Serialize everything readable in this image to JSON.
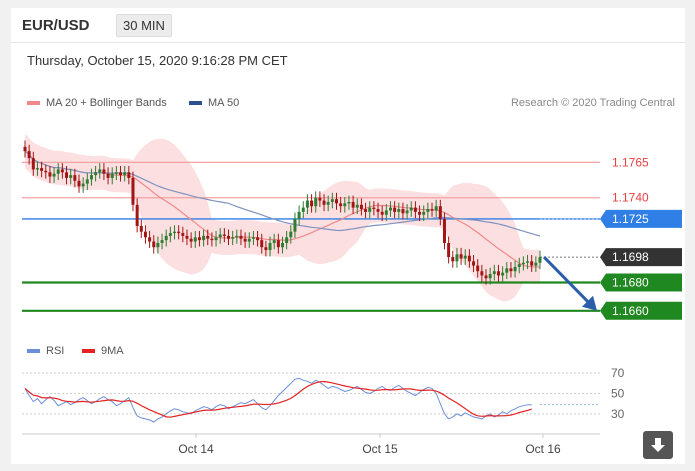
{
  "header": {
    "symbol": "EUR/USD",
    "interval": "30 MIN"
  },
  "datetime": "Thursday, October 15, 2020 9:16:28 PM CET",
  "legend": {
    "ma20": "MA 20 + Bollinger Bands",
    "ma50": "MA 50",
    "rsi": "RSI",
    "ma9": "9MA"
  },
  "credit": "Research © 2020 Trading Central",
  "colors": {
    "ma20": "#f08a8a",
    "ma50": "#3b6fc4",
    "band": "#fbd9da",
    "candle_up": "#2e7d32",
    "candle_down": "#a31515",
    "resistance": "#e74040",
    "support": "#208820",
    "pivot": "#2f7fe6",
    "price": "#333333",
    "arrow": "#2b5ea8",
    "rsi": "#6a8fd8",
    "rsi_ma": "#e42222"
  },
  "chart_data": {
    "type": "candlestick",
    "price_ylim": [
      1.1645,
      1.1795
    ],
    "levels": [
      {
        "label": "1.1765",
        "value": 1.1765,
        "kind": "resistance"
      },
      {
        "label": "1.1740",
        "value": 1.174,
        "kind": "resistance"
      },
      {
        "label": "1.1725",
        "value": 1.1725,
        "kind": "pivot"
      },
      {
        "label": "1.1698",
        "value": 1.1698,
        "kind": "price"
      },
      {
        "label": "1.1680",
        "value": 1.168,
        "kind": "support"
      },
      {
        "label": "1.1660",
        "value": 1.166,
        "kind": "support"
      }
    ],
    "x_ticks": [
      "Oct 14",
      "Oct 15",
      "Oct 16"
    ],
    "close": [
      1.1773,
      1.1768,
      1.176,
      1.1761,
      1.1759,
      1.1758,
      1.1755,
      1.1757,
      1.176,
      1.1758,
      1.1754,
      1.1756,
      1.1752,
      1.1748,
      1.175,
      1.1753,
      1.1756,
      1.1758,
      1.176,
      1.1757,
      1.1754,
      1.1757,
      1.1758,
      1.1756,
      1.1758,
      1.1754,
      1.1735,
      1.172,
      1.1716,
      1.1712,
      1.1709,
      1.1705,
      1.1708,
      1.171,
      1.1713,
      1.1715,
      1.1716,
      1.1715,
      1.1713,
      1.1711,
      1.1709,
      1.1712,
      1.171,
      1.1713,
      1.1711,
      1.171,
      1.1712,
      1.1714,
      1.1713,
      1.1711,
      1.1712,
      1.1713,
      1.1711,
      1.1709,
      1.1711,
      1.1712,
      1.171,
      1.1705,
      1.1703,
      1.1708,
      1.171,
      1.1705,
      1.1708,
      1.1712,
      1.1716,
      1.1725,
      1.173,
      1.1733,
      1.1738,
      1.1734,
      1.174,
      1.1738,
      1.1735,
      1.1737,
      1.1739,
      1.1736,
      1.1734,
      1.1736,
      1.1737,
      1.1733,
      1.1735,
      1.1732,
      1.173,
      1.1733,
      1.1732,
      1.173,
      1.1728,
      1.1731,
      1.1733,
      1.173,
      1.1732,
      1.1729,
      1.1731,
      1.1733,
      1.173,
      1.1728,
      1.173,
      1.1732,
      1.1731,
      1.1734,
      1.1725,
      1.1708,
      1.1698,
      1.1695,
      1.17,
      1.1697,
      1.1699,
      1.1695,
      1.1692,
      1.1688,
      1.1685,
      1.1683,
      1.1686,
      1.1688,
      1.1685,
      1.1687,
      1.169,
      1.1688,
      1.1691,
      1.1693,
      1.1694,
      1.1695,
      1.1692,
      1.1694,
      1.1698
    ],
    "rsi_ylim": [
      20,
      80
    ],
    "rsi_ticks": [
      "70",
      "50",
      "30"
    ],
    "rsi": [
      55,
      48,
      42,
      45,
      40,
      44,
      47,
      43,
      38,
      40,
      42,
      39,
      41,
      44,
      46,
      43,
      40,
      42,
      45,
      47,
      44,
      42,
      38,
      40,
      43,
      46,
      36,
      28,
      26,
      25,
      24,
      22,
      25,
      27,
      30,
      33,
      35,
      34,
      32,
      31,
      30,
      33,
      35,
      37,
      36,
      34,
      37,
      39,
      38,
      35,
      37,
      39,
      41,
      40,
      42,
      44,
      40,
      36,
      34,
      38,
      43,
      48,
      52,
      56,
      60,
      64,
      65,
      63,
      62,
      60,
      63,
      61,
      58,
      55,
      57,
      56,
      54,
      52,
      53,
      55,
      57,
      54,
      51,
      50,
      52,
      55,
      57,
      54,
      53,
      56,
      58,
      55,
      52,
      50,
      48,
      51,
      54,
      56,
      55,
      50,
      40,
      30,
      25,
      27,
      30,
      28,
      31,
      29,
      27,
      26,
      25,
      28,
      30,
      27,
      29,
      32,
      30,
      33,
      35,
      37,
      38,
      39,
      39
    ]
  }
}
